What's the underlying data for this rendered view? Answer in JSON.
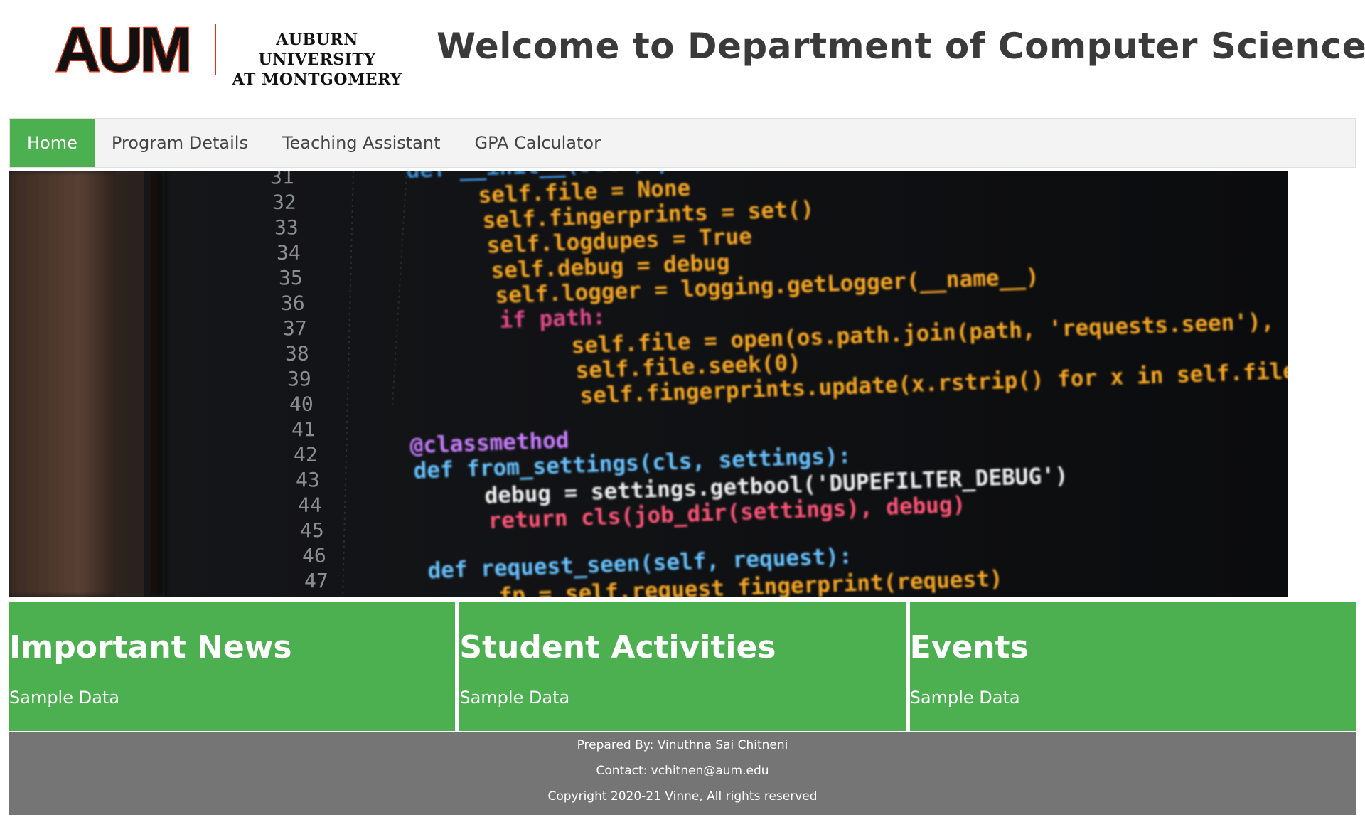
{
  "header": {
    "logo_mark": "AUM",
    "logo_line1": "AUBURN UNIVERSITY",
    "logo_line2": "AT MONTGOMERY",
    "title": "Welcome to Department of Computer Science"
  },
  "nav": {
    "items": [
      {
        "label": "Home",
        "active": true
      },
      {
        "label": "Program Details",
        "active": false
      },
      {
        "label": "Teaching Assistant",
        "active": false
      },
      {
        "label": "GPA Calculator",
        "active": false
      }
    ]
  },
  "hero": {
    "line_numbers": [
      "31",
      "32",
      "33",
      "34",
      "35",
      "36",
      "37",
      "38",
      "39",
      "40",
      "41",
      "42",
      "43",
      "44",
      "45",
      "46",
      "47"
    ],
    "code_lines": [
      "def __init__(self, path=None,",
      "self.file = None",
      "self.fingerprints = set()",
      "self.logdupes = True",
      "self.debug = debug",
      "self.logger = logging.getLogger(__name__)",
      "if path:",
      "self.file = open(os.path.join(path, 'requests.seen'),",
      "self.file.seek(0)",
      "self.fingerprints.update(x.rstrip() for x in self.file)",
      "",
      "@classmethod",
      "def from_settings(cls, settings):",
      "debug = settings.getbool('DUPEFILTER_DEBUG')",
      "return cls(job_dir(settings), debug)",
      "",
      "def request_seen(self, request):",
      "fp = self.request_fingerprint(request)"
    ]
  },
  "cards": [
    {
      "title": "Important News",
      "body": "Sample Data"
    },
    {
      "title": "Student Activities",
      "body": "Sample Data"
    },
    {
      "title": "Events",
      "body": "Sample Data"
    }
  ],
  "footer": {
    "prepared_by": "Prepared By: Vinuthna Sai Chitneni",
    "contact": "Contact: vchitnen@aum.edu",
    "copyright": "Copyright 2020-21 Vinne, All rights reserved"
  },
  "colors": {
    "accent": "#4caf50",
    "nav_bg": "#f3f3f3",
    "footer_bg": "#757575",
    "logo_orange": "#d2391c"
  }
}
